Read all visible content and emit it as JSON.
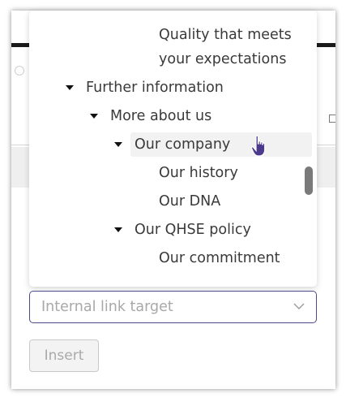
{
  "tree": {
    "items": [
      {
        "label": "Quality that meets",
        "expanded": false
      },
      {
        "label": "your expectations",
        "expanded": false
      },
      {
        "label": "Further information",
        "expanded": true
      },
      {
        "label": "More about us",
        "expanded": true
      },
      {
        "label": "Our company",
        "expanded": true,
        "selected": true
      },
      {
        "label": "Our history",
        "expanded": false
      },
      {
        "label": "Our DNA",
        "expanded": false
      },
      {
        "label": "Our QHSE policy",
        "expanded": true
      },
      {
        "label": "Our commitment",
        "expanded": false
      }
    ]
  },
  "link_target": {
    "placeholder": "Internal link target"
  },
  "insert_button": {
    "label": "Insert"
  },
  "colors": {
    "select_border": "#4b4b8a",
    "cursor": "#4b3a8c"
  }
}
